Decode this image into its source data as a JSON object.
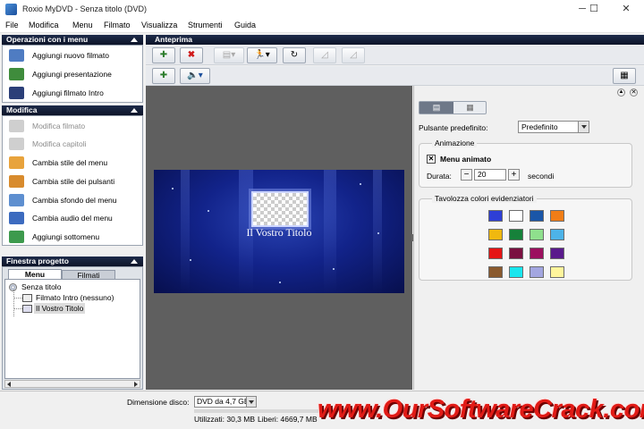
{
  "window": {
    "title": "Roxio MyDVD - Senza titolo  (DVD)",
    "minimize": "─",
    "maximize": "☐",
    "close": "✕"
  },
  "menubar": [
    "File",
    "Modifica",
    "Menu",
    "Filmato",
    "Visualizza",
    "Strumenti",
    "Guida"
  ],
  "operazioni": {
    "header": "Operazioni con i menu",
    "items": [
      {
        "label": "Aggiungi nuovo filmato",
        "icon": "add-movie-icon",
        "color": "#4f7cc2"
      },
      {
        "label": "Aggiungi presentazione",
        "icon": "add-slideshow-icon",
        "color": "#3f8c3c"
      },
      {
        "label": "Aggiungi filmato Intro",
        "icon": "add-intro-icon",
        "color": "#2b3f78"
      }
    ]
  },
  "modifica": {
    "header": "Modifica",
    "items": [
      {
        "label": "Modifica filmato",
        "icon": "edit-movie-icon",
        "color": "#c4c4c4",
        "disabled": true
      },
      {
        "label": "Modifica capitoli",
        "icon": "edit-chapters-icon",
        "color": "#c4c4c4",
        "disabled": true
      },
      {
        "label": "Cambia stile del menu",
        "icon": "menu-style-icon",
        "color": "#e8a33c",
        "disabled": false
      },
      {
        "label": "Cambia stile dei pulsanti",
        "icon": "button-style-icon",
        "color": "#d88b2d",
        "disabled": false
      },
      {
        "label": "Cambia sfondo del menu",
        "icon": "menu-background-icon",
        "color": "#5e8fd0",
        "disabled": false
      },
      {
        "label": "Cambia audio del menu",
        "icon": "menu-audio-icon",
        "color": "#3c6bbf",
        "disabled": false
      },
      {
        "label": "Aggiungi sottomenu",
        "icon": "add-submenu-icon",
        "color": "#3d9a4d",
        "disabled": false
      }
    ]
  },
  "progetto": {
    "header": "Finestra progetto",
    "tabs": [
      "Menu",
      "Filmati"
    ],
    "tree": [
      {
        "label": "Senza titolo",
        "icon": "disc-icon"
      },
      {
        "label": "Filmato Intro (nessuno)",
        "icon": "intro-film-icon"
      },
      {
        "label": "Il Vostro Titolo",
        "icon": "title-menu-icon"
      }
    ]
  },
  "anteprima": {
    "header": "Anteprima",
    "toolbar": {
      "add": "add-item-icon",
      "delete": "delete-icon",
      "align": "align-icon",
      "motion": "motion-icon",
      "loop": "loop-icon",
      "disabled1": "disabled-tool-icon",
      "disabled2": "disabled-tool-icon",
      "add2": "add-item-icon",
      "audio": "speaker-icon",
      "view": "view-toggle-icon"
    },
    "canvas_title": "Il Vostro Titolo"
  },
  "props": {
    "pulsante_label": "Pulsante predefinito:",
    "pulsante_value": "Predefinito",
    "animazione_title": "Animazione",
    "menu_animato_label": "Menu animato",
    "menu_animato_checked": true,
    "checkmark": "✕",
    "durata_label": "Durata:",
    "durata_value": "20",
    "durata_unit": "secondi",
    "minus": "−",
    "plus": "+",
    "tavolozza_title": "Tavolozza colori evidenziatori",
    "palette": [
      "#2e3fd6",
      "#ffffff",
      "#1a56a8",
      "#f07d17",
      "#f0b80f",
      "#16813a",
      "#8fe08d",
      "#4db3e8",
      "#e51515",
      "#7a1040",
      "#9c0f5f",
      "#5a1a8c",
      "#8a5a2e",
      "#19e6ee",
      "#a3a6e0",
      "#fff59c"
    ]
  },
  "status": {
    "dimensione_label": "Dimensione disco:",
    "dimensione_value": "DVD da 4,7 GB",
    "utilizzati": "Utilizzati: 30,3 MB",
    "liberi": "Liberi: 4669,7 MB"
  },
  "watermark": "www.OurSoftwareCrack.com"
}
